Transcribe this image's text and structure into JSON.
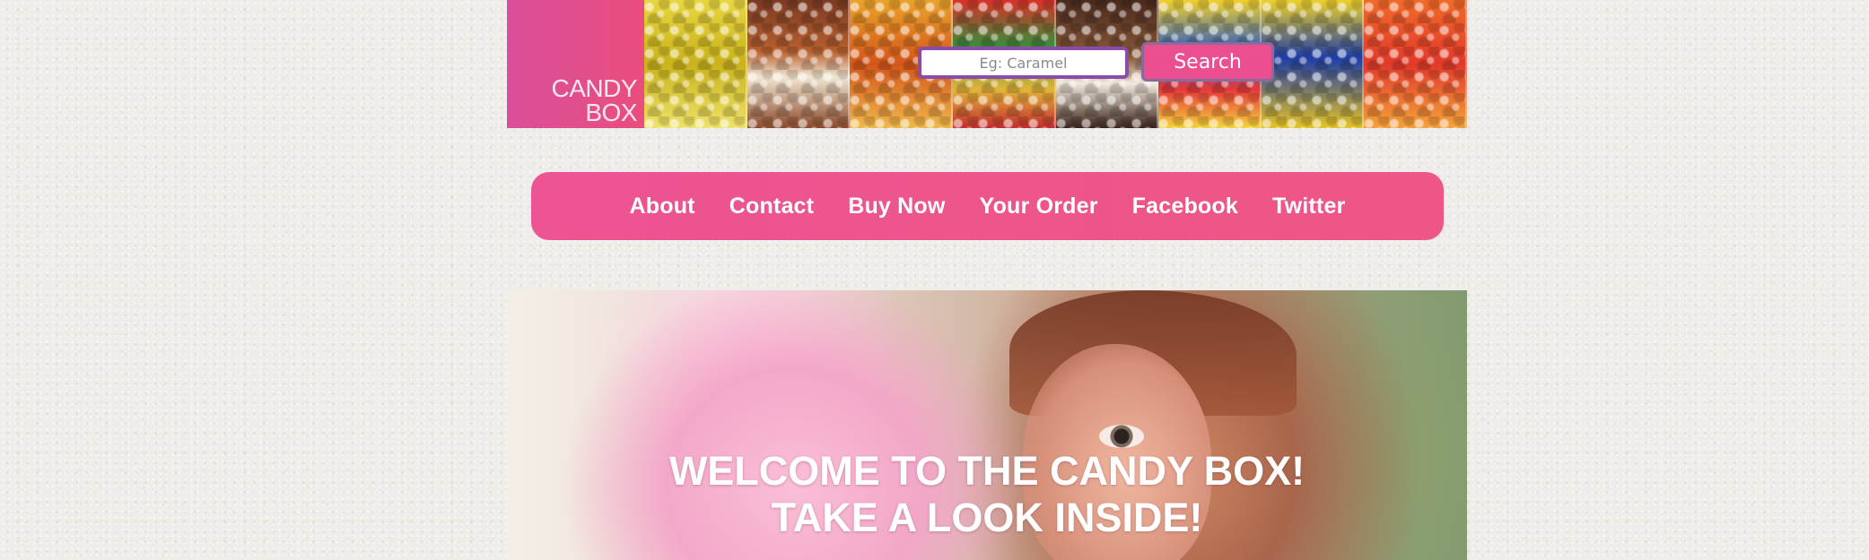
{
  "brand": {
    "line1": "CANDY",
    "line2": "BOX"
  },
  "search": {
    "placeholder": "Eg: Caramel",
    "button_label": "Search"
  },
  "nav": {
    "items": [
      {
        "label": "About"
      },
      {
        "label": "Contact"
      },
      {
        "label": "Buy Now"
      },
      {
        "label": "Your Order"
      },
      {
        "label": "Facebook"
      },
      {
        "label": "Twitter"
      }
    ]
  },
  "hero": {
    "line1": "WELCOME TO THE CANDY BOX!",
    "line2": "TAKE A LOOK INSIDE!"
  },
  "colors": {
    "brand_pink": "#ec5493",
    "logo_block": "#e04d8c",
    "search_border": "#8a4ca8",
    "page_background": "#eeede9"
  },
  "icons": {
    "header_banner": "candy-jars-image",
    "hero_banner": "cotton-candy-girl-image"
  }
}
